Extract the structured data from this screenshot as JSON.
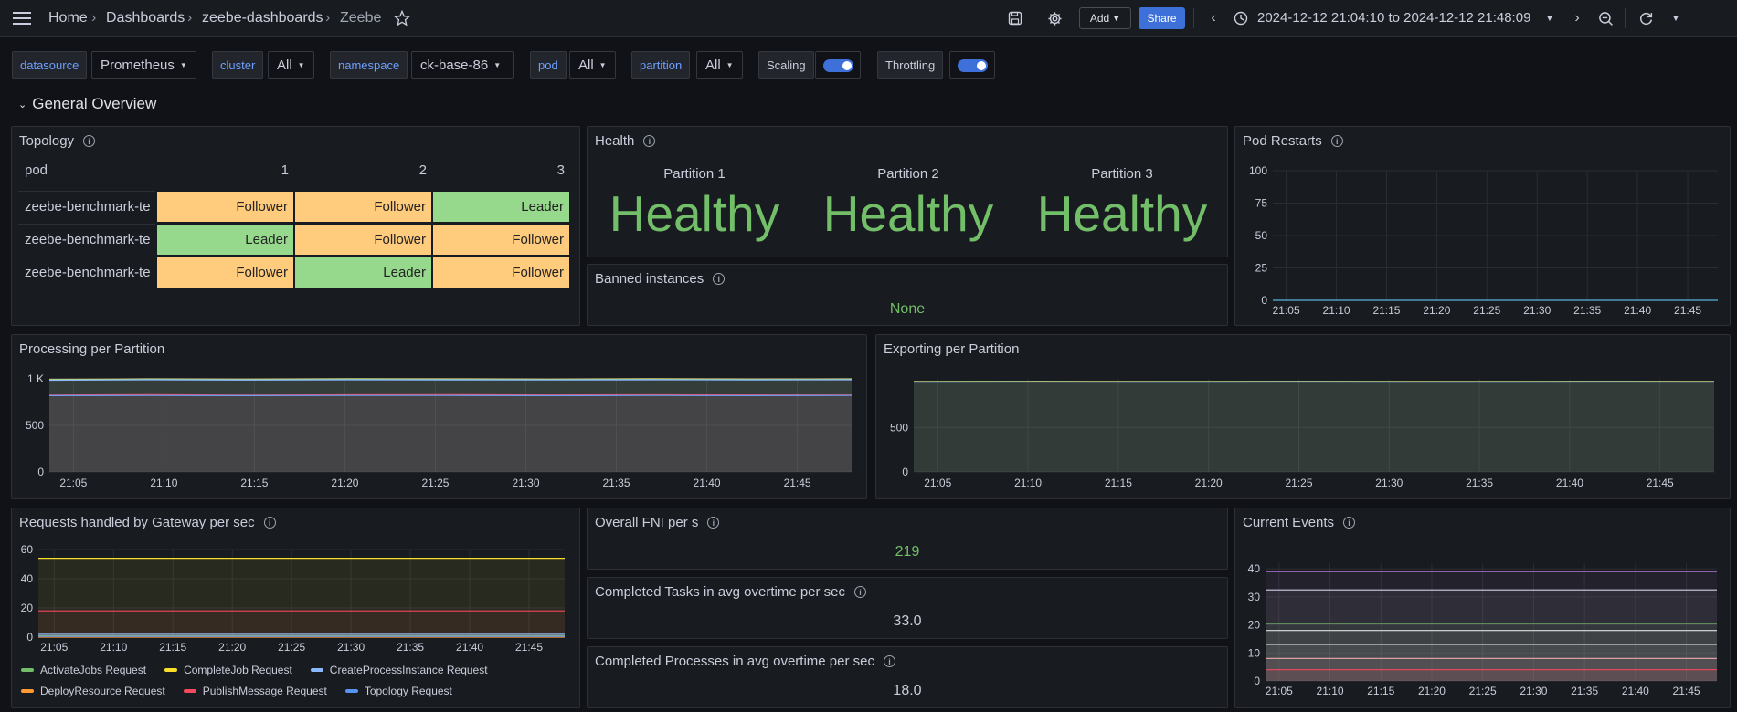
{
  "breadcrumbs": [
    "Home",
    "Dashboards",
    "zeebe-dashboards",
    "Zeebe"
  ],
  "toolbar": {
    "add_label": "Add",
    "share_label": "Share",
    "time_range": "2024-12-12 21:04:10 to 2024-12-12 21:48:09"
  },
  "variables": {
    "datasource": {
      "label": "datasource",
      "value": "Prometheus"
    },
    "cluster": {
      "label": "cluster",
      "value": "All"
    },
    "namespace": {
      "label": "namespace",
      "value": "ck-base-86"
    },
    "pod": {
      "label": "pod",
      "value": "All"
    },
    "partition": {
      "label": "partition",
      "value": "All"
    },
    "scaling": {
      "label": "Scaling",
      "on": true
    },
    "throttling": {
      "label": "Throttling",
      "on": true
    }
  },
  "row_title": "General Overview",
  "topology": {
    "title": "Topology",
    "headers": [
      "pod",
      "1",
      "2",
      "3"
    ],
    "rows": [
      {
        "pod": "zeebe-benchmark-te",
        "cells": [
          "Follower",
          "Follower",
          "Leader"
        ]
      },
      {
        "pod": "zeebe-benchmark-te",
        "cells": [
          "Leader",
          "Follower",
          "Follower"
        ]
      },
      {
        "pod": "zeebe-benchmark-te",
        "cells": [
          "Follower",
          "Leader",
          "Follower"
        ]
      }
    ]
  },
  "health": {
    "title": "Health",
    "partitions": [
      {
        "label": "Partition 1",
        "value": "Healthy"
      },
      {
        "label": "Partition 2",
        "value": "Healthy"
      },
      {
        "label": "Partition 3",
        "value": "Healthy"
      }
    ]
  },
  "banned": {
    "title": "Banned instances",
    "value": "None"
  },
  "pod_restarts": {
    "title": "Pod Restarts"
  },
  "processing": {
    "title": "Processing per Partition"
  },
  "exporting": {
    "title": "Exporting per Partition"
  },
  "requests": {
    "title": "Requests handled by Gateway per sec"
  },
  "fni": {
    "title": "Overall FNI per s",
    "value": "219"
  },
  "tasks": {
    "title": "Completed Tasks in avg overtime per sec",
    "value": "33.0"
  },
  "processes": {
    "title": "Completed Processes in avg overtime per sec",
    "value": "18.0"
  },
  "events": {
    "title": "Current Events"
  },
  "colors": {
    "leader": "#96d98d",
    "follower": "#ffcb7d",
    "healthy": "#73bf69",
    "accent": "#3d71d9"
  },
  "chart_data": [
    {
      "id": "pod_restarts",
      "type": "line",
      "title": "Pod Restarts",
      "x": [
        "21:05",
        "21:10",
        "21:15",
        "21:20",
        "21:25",
        "21:30",
        "21:35",
        "21:40",
        "21:45"
      ],
      "yticks": [
        0,
        25,
        50,
        75,
        100
      ],
      "ylim": [
        0,
        100
      ],
      "grid": true,
      "series": [
        {
          "color": "#5ab3d9",
          "values": [
            0,
            0,
            0,
            0,
            0,
            0,
            0,
            0,
            0
          ]
        }
      ]
    },
    {
      "id": "processing",
      "type": "area",
      "title": "Processing per Partition",
      "x": [
        "21:05",
        "21:10",
        "21:15",
        "21:20",
        "21:25",
        "21:30",
        "21:35",
        "21:40",
        "21:45"
      ],
      "yticks": [
        "0",
        "500",
        "1 K"
      ],
      "ylim": [
        0,
        1000
      ],
      "grid": true,
      "series": [
        {
          "color": "#e5ce6c",
          "values": [
            995,
            1000,
            998,
            1002,
            1000,
            998,
            1001,
            999,
            1000
          ]
        },
        {
          "color": "#96d98d",
          "values": [
            990,
            995,
            992,
            996,
            994,
            993,
            995,
            994,
            995
          ]
        },
        {
          "color": "#8ab8ff",
          "values": [
            985,
            990,
            987,
            990,
            989,
            988,
            990,
            989,
            990
          ]
        },
        {
          "color": "#f2495c",
          "values": [
            825,
            830,
            825,
            828,
            830,
            826,
            828,
            826,
            826
          ]
        },
        {
          "color": "#6d9ff7",
          "values": [
            820,
            822,
            820,
            822,
            822,
            820,
            822,
            820,
            822
          ]
        }
      ]
    },
    {
      "id": "exporting",
      "type": "area",
      "title": "Exporting per Partition",
      "x": [
        "21:05",
        "21:10",
        "21:15",
        "21:20",
        "21:25",
        "21:30",
        "21:35",
        "21:40",
        "21:45"
      ],
      "yticks": [
        0,
        500
      ],
      "ylim": [
        0,
        1050
      ],
      "grid": true,
      "series": [
        {
          "color": "#e5ce6c",
          "values": [
            1020,
            1022,
            1020,
            1021,
            1022,
            1020,
            1021,
            1022,
            1020
          ]
        },
        {
          "color": "#96d98d",
          "values": [
            1016,
            1018,
            1016,
            1017,
            1018,
            1016,
            1017,
            1018,
            1016
          ]
        },
        {
          "color": "#6d9ff7",
          "values": [
            1012,
            1014,
            1012,
            1013,
            1014,
            1012,
            1013,
            1014,
            1012
          ]
        }
      ]
    },
    {
      "id": "requests",
      "type": "area",
      "title": "Requests handled by Gateway per sec",
      "x": [
        "21:05",
        "21:10",
        "21:15",
        "21:20",
        "21:25",
        "21:30",
        "21:35",
        "21:40",
        "21:45"
      ],
      "yticks": [
        0,
        20,
        40,
        60
      ],
      "ylim": [
        0,
        60
      ],
      "grid": true,
      "legend": [
        "ActivateJobs Request",
        "CompleteJob Request",
        "CreateProcessInstance Request",
        "DeployResource Request",
        "PublishMessage Request",
        "Topology Request"
      ],
      "series": [
        {
          "name": "ActivateJobs Request",
          "color": "#73bf69",
          "values": [
            1,
            1,
            1,
            1,
            1,
            1,
            1,
            1,
            1
          ]
        },
        {
          "name": "CompleteJob Request",
          "color": "#fade2a",
          "values": [
            54,
            54,
            54,
            54,
            54,
            54,
            54,
            54,
            54
          ]
        },
        {
          "name": "CreateProcessInstance Request",
          "color": "#8ab8ff",
          "values": [
            2,
            2,
            2,
            2,
            2,
            2,
            2,
            2,
            2
          ]
        },
        {
          "name": "DeployResource Request",
          "color": "#ff9830",
          "values": [
            0,
            0,
            0,
            0,
            0,
            0,
            0,
            0,
            0
          ]
        },
        {
          "name": "PublishMessage Request",
          "color": "#f2495c",
          "values": [
            18,
            18,
            18,
            18,
            18,
            18,
            18,
            18,
            18
          ]
        },
        {
          "name": "Topology Request",
          "color": "#5794f2",
          "values": [
            0.5,
            0.5,
            0.5,
            0.5,
            0.5,
            0.5,
            0.5,
            0.5,
            0.5
          ]
        }
      ]
    },
    {
      "id": "events",
      "type": "area",
      "title": "Current Events",
      "x": [
        "21:05",
        "21:10",
        "21:15",
        "21:20",
        "21:25",
        "21:30",
        "21:35",
        "21:40",
        "21:45"
      ],
      "yticks": [
        0,
        10,
        20,
        30,
        40
      ],
      "ylim": [
        0,
        42
      ],
      "grid": true,
      "series": [
        {
          "color": "#b877d9",
          "values": [
            39,
            39,
            39,
            39,
            39,
            39,
            39,
            39,
            39
          ]
        },
        {
          "color": "#cfcfe8",
          "values": [
            32.5,
            32.5,
            32.5,
            32.5,
            32.5,
            32.5,
            32.5,
            32.5,
            32.5
          ]
        },
        {
          "color": "#73bf69",
          "values": [
            20.5,
            20.5,
            20.5,
            20.5,
            20.5,
            20.5,
            20.5,
            20.5,
            20.5
          ]
        },
        {
          "color": "#e0e0e0",
          "values": [
            18,
            18,
            18,
            18,
            18,
            18,
            18,
            18,
            18
          ]
        },
        {
          "color": "#b8b8b8",
          "values": [
            13,
            13,
            13,
            13,
            13,
            13,
            13,
            13,
            13
          ]
        },
        {
          "color": "#d8a0a0",
          "values": [
            8,
            8,
            8,
            8,
            8,
            8,
            8,
            8,
            8
          ]
        },
        {
          "color": "#f2495c",
          "values": [
            4,
            4,
            4,
            4,
            4,
            4,
            4,
            4,
            4
          ]
        }
      ]
    }
  ]
}
